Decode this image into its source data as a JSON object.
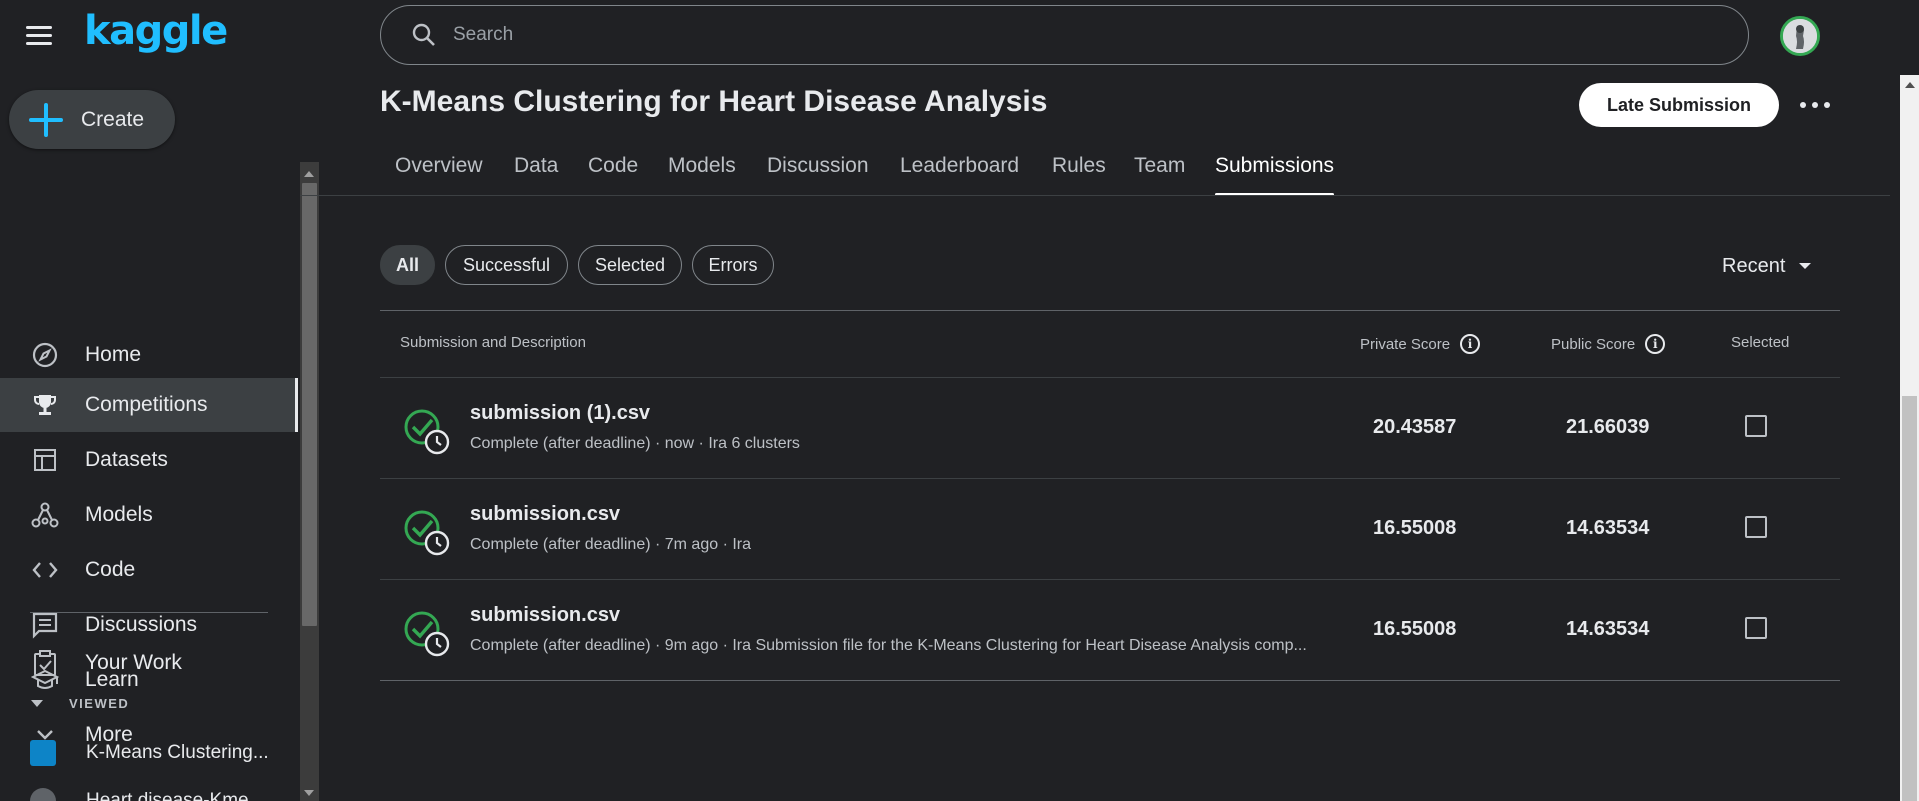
{
  "brand": {
    "logo": "kaggle"
  },
  "create": {
    "label": "Create"
  },
  "sidebar": {
    "items": [
      {
        "label": "Home",
        "icon": "compass-icon"
      },
      {
        "label": "Competitions",
        "icon": "trophy-icon",
        "active": true
      },
      {
        "label": "Datasets",
        "icon": "table-icon"
      },
      {
        "label": "Models",
        "icon": "models-icon"
      },
      {
        "label": "Code",
        "icon": "code-icon"
      },
      {
        "label": "Discussions",
        "icon": "discussion-icon"
      },
      {
        "label": "Learn",
        "icon": "school-icon"
      },
      {
        "label": "More",
        "icon": "chevron-down-icon"
      }
    ],
    "your_work": "Your Work",
    "viewed_heading": "VIEWED",
    "viewed": [
      {
        "label": "K-Means Clustering...",
        "color": "#0d84c7"
      },
      {
        "label": "Heart disease-Kme...",
        "color": "#5f6368"
      }
    ]
  },
  "search": {
    "placeholder": "Search"
  },
  "competition": {
    "title": "K-Means Clustering for Heart Disease Analysis",
    "late_submission": "Late Submission"
  },
  "tabs": [
    {
      "label": "Overview"
    },
    {
      "label": "Data"
    },
    {
      "label": "Code"
    },
    {
      "label": "Models"
    },
    {
      "label": "Discussion"
    },
    {
      "label": "Leaderboard"
    },
    {
      "label": "Rules"
    },
    {
      "label": "Team"
    },
    {
      "label": "Submissions",
      "active": true
    }
  ],
  "filters": [
    {
      "label": "All",
      "active": true
    },
    {
      "label": "Successful"
    },
    {
      "label": "Selected"
    },
    {
      "label": "Errors"
    }
  ],
  "sort": {
    "label": "Recent"
  },
  "table": {
    "headers": {
      "submission": "Submission and Description",
      "private": "Private Score",
      "public": "Public Score",
      "selected": "Selected"
    },
    "rows": [
      {
        "file": "submission (1).csv",
        "desc": "Complete (after deadline) · now · Ira 6 clusters",
        "private": "20.43587",
        "public": "21.66039",
        "selected": false
      },
      {
        "file": "submission.csv",
        "desc": "Complete (after deadline) · 7m ago · Ira",
        "private": "16.55008",
        "public": "14.63534",
        "selected": false
      },
      {
        "file": "submission.csv",
        "desc": "Complete (after deadline) · 9m ago · Ira Submission file for the K-Means Clustering for Heart Disease Analysis comp...",
        "private": "16.55008",
        "public": "14.63534",
        "selected": false
      }
    ]
  },
  "colors": {
    "accent": "#20beff",
    "success": "#34a853",
    "background": "#202124"
  }
}
